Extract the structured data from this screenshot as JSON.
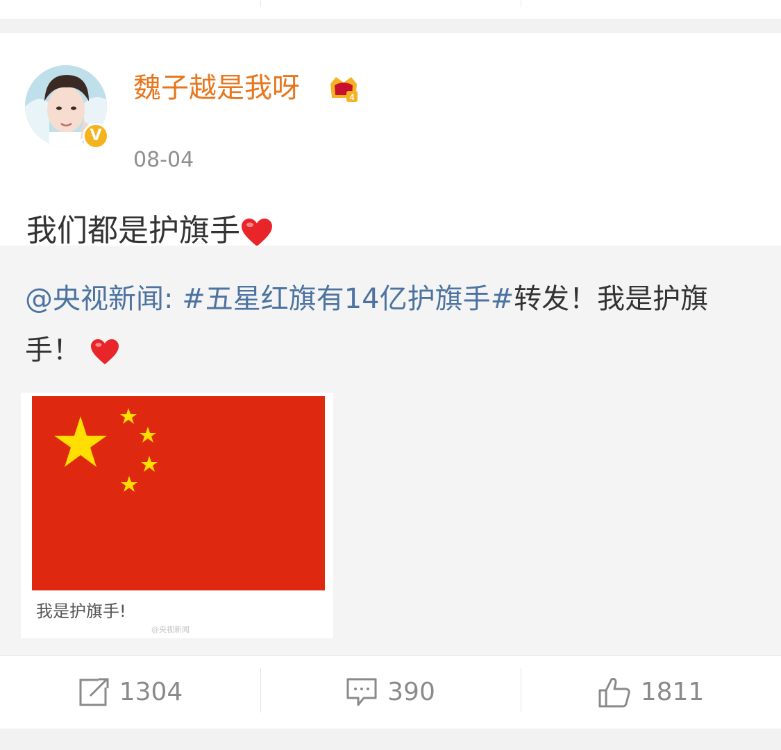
{
  "post": {
    "username": "魏子越是我呀",
    "time": "08-04",
    "text": "我们都是护旗手",
    "verified_badge": "V"
  },
  "repost": {
    "author": "@央视新闻",
    "colon": ": ",
    "hashtag": "#五星红旗有14亿护旗手#",
    "text": "转发！我是护旗手！"
  },
  "image": {
    "caption": "我是护旗手!",
    "watermark": "@央视新闻"
  },
  "actions": {
    "repost_count": "1304",
    "comment_count": "390",
    "like_count": "1811"
  },
  "colors": {
    "username": "#e8761c",
    "link": "#4d73a0",
    "flag_red": "#de2910",
    "flag_star": "#ffde00"
  }
}
